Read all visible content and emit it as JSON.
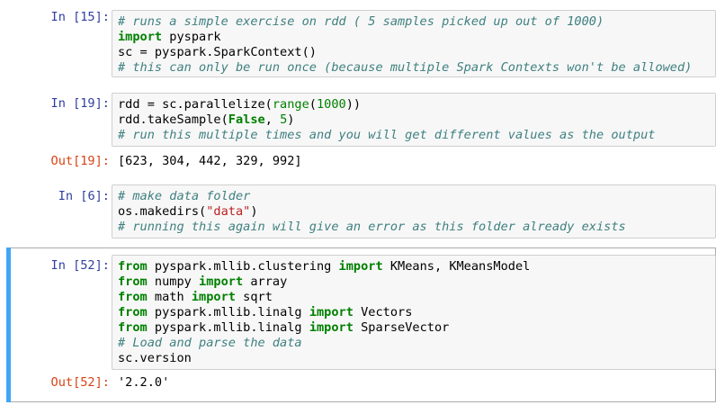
{
  "cells": [
    {
      "in_prompt": "In [15]:",
      "code": [
        [
          [
            "c",
            "# runs a simple exercise on rdd ( 5 samples picked up out of 1000)"
          ]
        ],
        [
          [
            "k",
            "import"
          ],
          [
            "",
            " pyspark"
          ]
        ],
        [
          [
            "",
            "sc = pyspark.SparkContext()"
          ]
        ],
        [
          [
            "c",
            "# this can only be run once (because multiple Spark Contexts won't be allowed)"
          ]
        ]
      ]
    },
    {
      "in_prompt": "In [19]:",
      "code": [
        [
          [
            "",
            "rdd = sc.parallelize("
          ],
          [
            "b",
            "range"
          ],
          [
            "",
            "("
          ],
          [
            "n",
            "1000"
          ],
          [
            "",
            "))"
          ]
        ],
        [
          [
            "",
            "rdd.takeSample("
          ],
          [
            "k",
            "False"
          ],
          [
            "",
            ", "
          ],
          [
            "n",
            "5"
          ],
          [
            "",
            ")"
          ]
        ],
        [
          [
            "c",
            "# run this multiple times and you will get different values as the output"
          ]
        ]
      ],
      "out_prompt": "Out[19]:",
      "output": "[623, 304, 442, 329, 992]"
    },
    {
      "in_prompt": "In [6]:",
      "code": [
        [
          [
            "c",
            "# make data folder"
          ]
        ],
        [
          [
            "",
            "os.makedirs("
          ],
          [
            "s",
            "\"data\""
          ],
          [
            "",
            ")"
          ]
        ],
        [
          [
            "c",
            "# running this again will give an error as this folder already exists"
          ]
        ]
      ]
    },
    {
      "in_prompt": "In [52]:",
      "selected": true,
      "code": [
        [
          [
            "k",
            "from"
          ],
          [
            "",
            " pyspark.mllib.clustering "
          ],
          [
            "k",
            "import"
          ],
          [
            "",
            " KMeans, KMeansModel"
          ]
        ],
        [
          [
            "k",
            "from"
          ],
          [
            "",
            " numpy "
          ],
          [
            "k",
            "import"
          ],
          [
            "",
            " array"
          ]
        ],
        [
          [
            "k",
            "from"
          ],
          [
            "",
            " math "
          ],
          [
            "k",
            "import"
          ],
          [
            "",
            " sqrt"
          ]
        ],
        [
          [
            "k",
            "from"
          ],
          [
            "",
            " pyspark.mllib.linalg "
          ],
          [
            "k",
            "import"
          ],
          [
            "",
            " Vectors"
          ]
        ],
        [
          [
            "k",
            "from"
          ],
          [
            "",
            " pyspark.mllib.linalg "
          ],
          [
            "k",
            "import"
          ],
          [
            "",
            " SparseVector"
          ]
        ],
        [
          [
            "c",
            "# Load and parse the data"
          ]
        ],
        [
          [
            "",
            "sc.version"
          ]
        ]
      ],
      "out_prompt": "Out[52]:",
      "output": "'2.2.0'"
    }
  ]
}
